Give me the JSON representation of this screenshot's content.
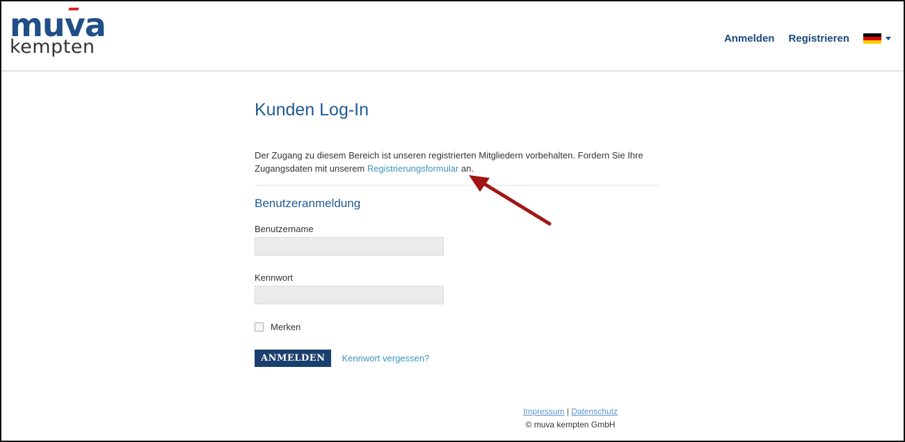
{
  "header": {
    "logo": {
      "word": "muva",
      "sub": "kempten"
    },
    "nav": {
      "login_label": "Anmelden",
      "register_label": "Registrieren"
    },
    "language": {
      "flag_colors": [
        "#000000",
        "#dd0000",
        "#ffce00"
      ]
    }
  },
  "main": {
    "title": "Kunden Log-In",
    "intro": {
      "before_link": "Der Zugang zu diesem Bereich ist unseren registrierten Mitgliedern vorbehalten. Fordern Sie Ihre Zugangsdaten mit unserem ",
      "link_text": "Registrierungsformular",
      "after_link": " an."
    },
    "section_title": "Benutzeranmeldung",
    "username_label": "Benutzername",
    "username_value": "",
    "password_label": "Kennwort",
    "password_value": "",
    "remember_label": "Merken",
    "submit_label": "ANMELDEN",
    "forgot_label": "Kennwort vergessen?"
  },
  "footer": {
    "impressum": "Impressum",
    "separator": "|",
    "datenschutz": "Datenschutz",
    "copyright": "© muva kempten GmbH"
  },
  "colors": {
    "brand_blue": "#1f4f86",
    "link_blue": "#3a93c1",
    "button_bg": "#1a3f6f",
    "annotation_arrow": "#a31515"
  }
}
